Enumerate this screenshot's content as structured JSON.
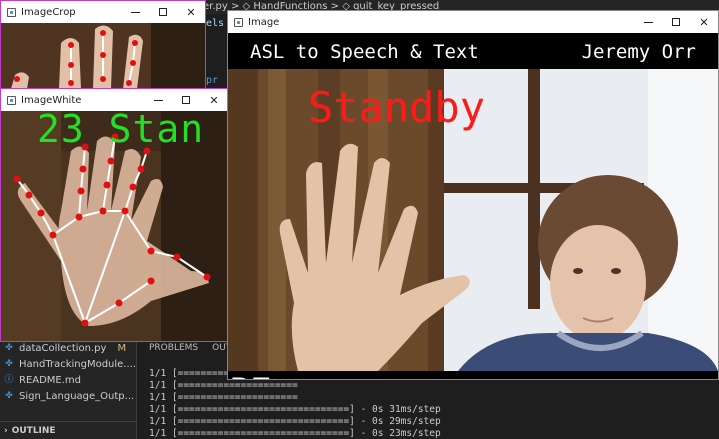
{
  "editor": {
    "breadcrumb": "er.py > ◇ HandFunctions > ◇ quit_key_pressed",
    "code_fragments": [
      "els",
      "pr"
    ]
  },
  "explorer": {
    "files": [
      {
        "name": "dataCollection.py",
        "badge": "M",
        "icon": "python-file-icon"
      },
      {
        "name": "HandTrackingModule....",
        "badge": "",
        "icon": "python-file-icon"
      },
      {
        "name": "README.md",
        "badge": "",
        "icon": "info-file-icon"
      },
      {
        "name": "Sign_Language_Outp...",
        "badge": "",
        "icon": "python-file-icon"
      }
    ],
    "outline_label": "OUTLINE"
  },
  "terminal": {
    "tabs": [
      "PROBLEMS",
      "OUT"
    ],
    "lines": [
      "1/1 [=====================",
      "1/1 [=====================",
      "1/1 [=====================",
      "1/1 [=====================",
      "1/1 [==============================] - 0s 31ms/step",
      "1/1 [==============================] - 0s 29ms/step",
      "1/1 [==============================] - 0s 23ms/step"
    ]
  },
  "windows": {
    "crop": {
      "title": "ImageCrop"
    },
    "white": {
      "title": "ImageWhite",
      "label": "23 Stan"
    },
    "main": {
      "title": "Image",
      "header_left": "ASL to Speech & Text",
      "header_right": "Jeremy Orr",
      "status": "Standby",
      "spoken_text": "BE"
    }
  },
  "colors": {
    "status_red": "#ff1a1a",
    "label_green": "#22e022",
    "landmark_red": "#e01010",
    "crop_border": "#c23bc8"
  }
}
